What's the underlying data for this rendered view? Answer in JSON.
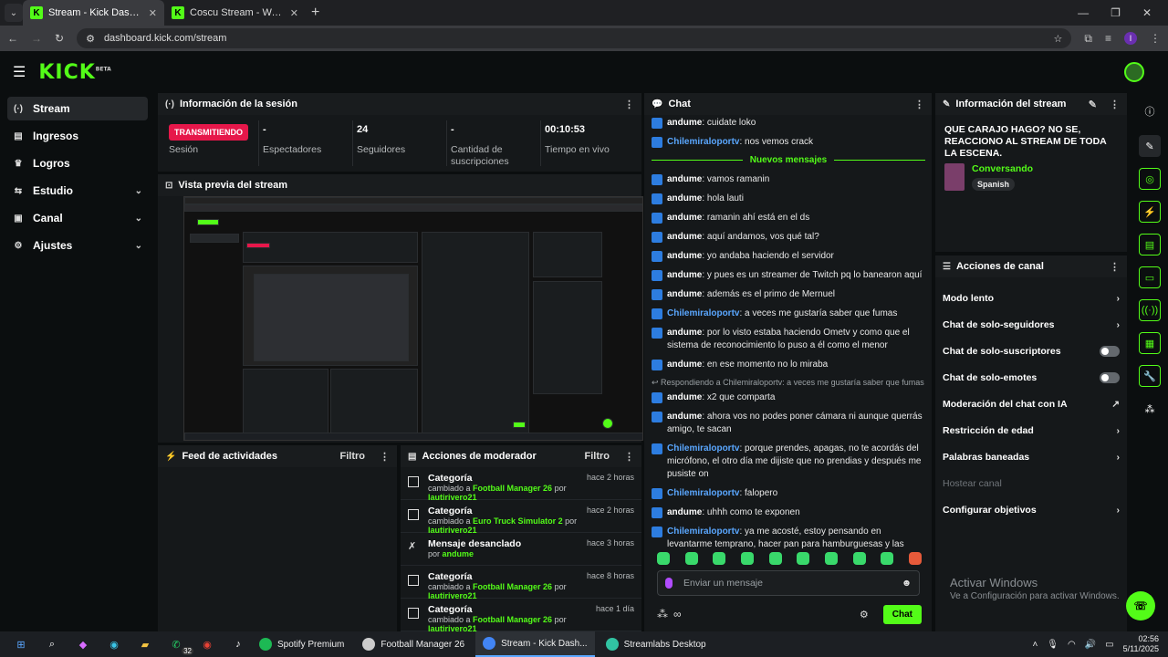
{
  "browser": {
    "tabs": [
      {
        "title": "Stream - Kick Dashboard",
        "active": true
      },
      {
        "title": "Coscu Stream - Watch Live",
        "active": false
      }
    ],
    "url": "dashboard.kick.com/stream",
    "profile_initial": "I"
  },
  "header": {
    "logo": "KICK",
    "logo_sup": "BETA"
  },
  "sidebar": {
    "items": [
      {
        "label": "Stream",
        "icon": "broadcast-icon"
      },
      {
        "label": "Ingresos",
        "icon": "money-icon"
      },
      {
        "label": "Logros",
        "icon": "trophy-icon"
      },
      {
        "label": "Estudio",
        "icon": "studio-icon"
      },
      {
        "label": "Canal",
        "icon": "channel-icon"
      },
      {
        "label": "Ajustes",
        "icon": "gear-icon"
      }
    ]
  },
  "session": {
    "title": "Información de la sesión",
    "live_badge": "TRANSMITIENDO",
    "stats": [
      {
        "value": "",
        "label": "Sesión"
      },
      {
        "value": "-",
        "label": "Espectadores"
      },
      {
        "value": "24",
        "label": "Seguidores"
      },
      {
        "value": "-",
        "label": "Cantidad de suscripciones"
      },
      {
        "value": "00:10:53",
        "label": "Tiempo en vivo"
      }
    ]
  },
  "preview": {
    "title": "Vista previa del stream"
  },
  "activity": {
    "title": "Feed de actividades",
    "filter": "Filtro"
  },
  "mod_actions": {
    "title": "Acciones de moderador",
    "filter": "Filtro",
    "items": [
      {
        "title": "Categoría",
        "prefix": "cambiado a",
        "target": "Football Manager 26",
        "by": "por",
        "user": "lautirivero21",
        "time": "hace 2 horas"
      },
      {
        "title": "Categoría",
        "prefix": "cambiado a",
        "target": "Euro Truck Simulator 2",
        "by": "por",
        "user": "lautirivero21",
        "time": "hace 2 horas"
      },
      {
        "title": "Mensaje desanclado",
        "prefix": "",
        "target": "",
        "by": "por",
        "user": "andume",
        "time": "hace 3 horas"
      },
      {
        "title": "Categoría",
        "prefix": "cambiado a",
        "target": "Football Manager 26",
        "by": "por",
        "user": "lautirivero21",
        "time": "hace 8 horas"
      },
      {
        "title": "Categoría",
        "prefix": "cambiado a",
        "target": "Football Manager 26",
        "by": "por",
        "user": "lautirivero21",
        "time": "hace 1 día"
      }
    ]
  },
  "chat": {
    "title": "Chat",
    "new_messages": "Nuevos mensajes",
    "before": [
      {
        "user": "andume",
        "blue": false,
        "text": "cuidate loko"
      },
      {
        "user": "Chilemiraloportv",
        "blue": true,
        "text": "nos vemos crack"
      }
    ],
    "after": [
      {
        "user": "andume",
        "blue": false,
        "text": "vamos ramanin"
      },
      {
        "user": "andume",
        "blue": false,
        "text": "hola lauti"
      },
      {
        "user": "andume",
        "blue": false,
        "text": "ramanin ahí está en el ds"
      },
      {
        "user": "andume",
        "blue": false,
        "text": "aquí andamos, vos qué tal?"
      },
      {
        "user": "andume",
        "blue": false,
        "text": "yo andaba haciendo el servidor"
      },
      {
        "user": "andume",
        "blue": false,
        "text": "y pues es un streamer de Twitch pq lo banearon aquí"
      },
      {
        "user": "andume",
        "blue": false,
        "text": "además es el primo de Mernuel"
      },
      {
        "user": "Chilemiraloportv",
        "blue": true,
        "text": "a veces me gustaría saber que fumas"
      },
      {
        "user": "andume",
        "blue": false,
        "text": "por lo visto estaba haciendo Ometv y como que el sistema de reconocimiento lo puso a él como el menor"
      },
      {
        "user": "andume",
        "blue": false,
        "text": "en ese momento no lo miraba"
      }
    ],
    "reply_note": "Respondiendo a Chilemiraloportv: a veces me gustaría saber que fumas",
    "after_reply": [
      {
        "user": "andume",
        "blue": false,
        "text": "x2 que comparta"
      },
      {
        "user": "andume",
        "blue": false,
        "text": "ahora vos no podes poner cámara ni aunque querrás amigo, te sacan"
      },
      {
        "user": "Chilemiraloportv",
        "blue": true,
        "text": "porque prendes, apagas, no te acordás del micrófono, el otro día me dijiste que no prendias y después me pusiste on"
      },
      {
        "user": "Chilemiraloportv",
        "blue": true,
        "text": "falopero"
      },
      {
        "user": "andume",
        "blue": false,
        "text": "uhhh como te exponen"
      },
      {
        "user": "Chilemiraloportv",
        "blue": true,
        "text": "ya me acosté, estoy pensando en levantarme temprano, hacer pan para hamburguesas y las mismas caseras"
      }
    ],
    "input_placeholder": "Enviar un mensaje",
    "send_label": "Chat"
  },
  "stream_info": {
    "title": "Información del stream",
    "stream_title": "QUE CARAJO HAGO? NO SE, REACCIONO AL STREAM DE TODA LA ESCENA.",
    "category": "Conversando",
    "language": "Spanish"
  },
  "channel_actions": {
    "title": "Acciones de canal",
    "items": [
      {
        "label": "Modo lento",
        "kind": "chevron"
      },
      {
        "label": "Chat de solo-seguidores",
        "kind": "chevron"
      },
      {
        "label": "Chat de solo-suscriptores",
        "kind": "toggle"
      },
      {
        "label": "Chat de solo-emotes",
        "kind": "toggle"
      },
      {
        "label": "Moderación del chat con IA",
        "kind": "external"
      },
      {
        "label": "Restricción de edad",
        "kind": "chevron"
      },
      {
        "label": "Palabras baneadas",
        "kind": "chevron"
      },
      {
        "label": "Hostear canal",
        "kind": "disabled"
      },
      {
        "label": "Configurar objetivos",
        "kind": "chevron"
      }
    ]
  },
  "windows_watermark": {
    "line1": "Activar Windows",
    "line2": "Ve a Configuración para activar Windows."
  },
  "taskbar": {
    "apps": [
      {
        "label": "Spotify Premium",
        "color": "#1db954"
      },
      {
        "label": "Football Manager 26",
        "color": "#cccccc"
      },
      {
        "label": "Stream - Kick Dash...",
        "color": "#4285f4"
      },
      {
        "label": "Streamlabs Desktop",
        "color": "#31c3a2"
      }
    ],
    "badge": "32",
    "time": "02:56",
    "date": "5/11/2025"
  }
}
